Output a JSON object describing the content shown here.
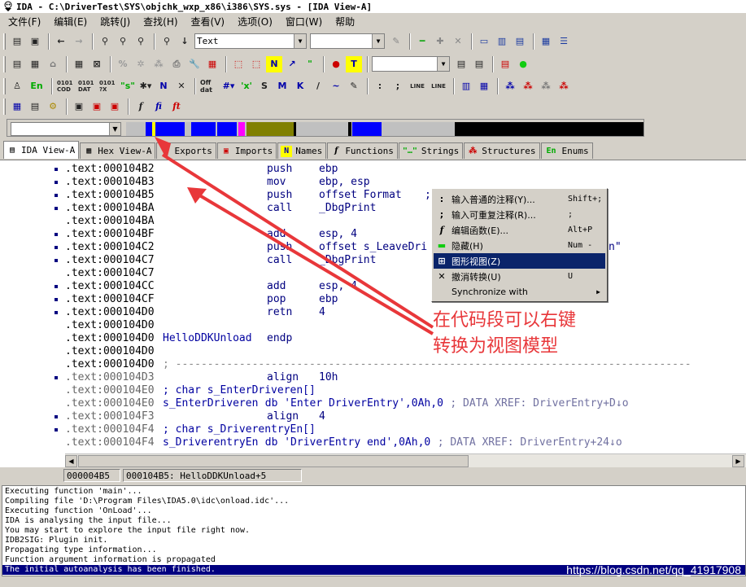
{
  "window": {
    "title": "IDA - C:\\DriverTest\\SYS\\objchk_wxp_x86\\i386\\SYS.sys - [IDA View-A]"
  },
  "menu": [
    "文件(F)",
    "编辑(E)",
    "跳转(J)",
    "查找(H)",
    "查看(V)",
    "选项(O)",
    "窗口(W)",
    "帮助"
  ],
  "toolbar": {
    "segment_combo_value": "Text",
    "second_combo_value": ""
  },
  "tabs": [
    {
      "label": "IDA View-A",
      "icon": "ida-view-icon"
    },
    {
      "label": "Hex View-A",
      "icon": "hex-view-icon"
    },
    {
      "label": "Exports",
      "icon": "exports-icon"
    },
    {
      "label": "Imports",
      "icon": "imports-icon"
    },
    {
      "label": "Names",
      "icon": "names-icon"
    },
    {
      "label": "Functions",
      "icon": "functions-icon"
    },
    {
      "label": "Strings",
      "icon": "strings-icon"
    },
    {
      "label": "Structures",
      "icon": "structures-icon"
    },
    {
      "label": "Enums",
      "icon": "enums-icon"
    }
  ],
  "disasm": [
    {
      "addr": ".text:000104B2",
      "mnem": "push",
      "ops": "ebp",
      "dot": true
    },
    {
      "addr": ".text:000104B3",
      "mnem": "mov",
      "ops": "ebp, esp",
      "dot": true
    },
    {
      "addr": ".text:000104B5",
      "mnem": "push",
      "ops": "offset Format",
      "tail": ";",
      "dot": true
    },
    {
      "addr": ".text:000104BA",
      "mnem": "call",
      "ops": "_DbgPrint",
      "dot": true
    },
    {
      "addr": ".text:000104BA",
      "mnem": "",
      "ops": ""
    },
    {
      "addr": ".text:000104BF",
      "mnem": "add",
      "ops": "esp, 4",
      "dot": true
    },
    {
      "addr": ".text:000104C2",
      "mnem": "push",
      "ops": "offset s_LeaveDri",
      "tail": "n\"",
      "dot": true
    },
    {
      "addr": ".text:000104C7",
      "mnem": "call",
      "ops": "_DbgPrint",
      "dot": true
    },
    {
      "addr": ".text:000104C7",
      "mnem": "",
      "ops": ""
    },
    {
      "addr": ".text:000104CC",
      "mnem": "add",
      "ops": "esp, 4",
      "dot": true
    },
    {
      "addr": ".text:000104CF",
      "mnem": "pop",
      "ops": "ebp",
      "dot": true
    },
    {
      "addr": ".text:000104D0",
      "mnem": "retn",
      "ops": "4",
      "dot": true
    },
    {
      "addr": ".text:000104D0",
      "mnem": "",
      "ops": ""
    },
    {
      "addr": ".text:000104D0",
      "label": "HelloDDKUnload",
      "mnem": "endp",
      "ops": ""
    },
    {
      "addr": ".text:000104D0",
      "mnem": "",
      "ops": ""
    },
    {
      "addr": ".text:000104D0",
      "dash": "; ---------------------------------------------------------------------------------"
    },
    {
      "addr": ".text:000104D3",
      "mnem": "align",
      "ops": "10h",
      "grey": true,
      "dot": true
    },
    {
      "addr": ".text:000104E0",
      "label": "; char s_EnterDriveren[]",
      "grey": true
    },
    {
      "addr": ".text:000104E0",
      "label": "s_EnterDriveren",
      "rest": "db 'Enter DriverEntry',0Ah,0",
      "cmt": "; DATA XREF: DriverEntry+D↓o",
      "grey": true
    },
    {
      "addr": ".text:000104F3",
      "mnem": "align",
      "ops": "4",
      "grey": true,
      "dot": true
    },
    {
      "addr": ".text:000104F4",
      "label": "; char s_DriverentryEn[]",
      "grey": true,
      "dot": true
    },
    {
      "addr": ".text:000104F4",
      "label": "s_DriverentryEn",
      "rest": "db 'DriverEntry end',0Ah,0",
      "cmt": "; DATA XREF: DriverEntry+24↓o",
      "grey": true
    }
  ],
  "status": {
    "offset": "000004B5",
    "location": "000104B5: HelloDDKUnload+5"
  },
  "log": [
    "Executing function 'main'...",
    "Compiling file 'D:\\Program Files\\IDA5.0\\idc\\onload.idc'...",
    "Executing function 'OnLoad'...",
    "IDA is analysing the input file...",
    "You may start to explore the input file right now.",
    "IDB2SIG: Plugin init.",
    "Propagating type information...",
    "Function argument information is propagated",
    "The initial autoanalysis has been finished."
  ],
  "context_menu": [
    {
      "icon": ":",
      "label": "输入普通的注释(Y)...",
      "shortcut": "Shift+;",
      "name": "ctx-enter-comment",
      "icon_name": "colon-icon"
    },
    {
      "icon": ";",
      "label": "输入可重复注释(R)...",
      "shortcut": ";",
      "name": "ctx-enter-repeatable-comment",
      "icon_name": "semicolon-icon"
    },
    {
      "icon": "f",
      "label": "编辑函数(E)...",
      "shortcut": "Alt+P",
      "name": "ctx-edit-function",
      "icon_name": "function-icon"
    },
    {
      "icon": "▬",
      "label": "隐藏(H)",
      "shortcut": "Num -",
      "name": "ctx-hide",
      "icon_name": "minus-icon"
    },
    {
      "icon": "⊞",
      "label": "图形视图(Z)",
      "shortcut": "",
      "name": "ctx-graph-view",
      "icon_name": "graph-view-icon",
      "highlight": true
    },
    {
      "icon": "✕",
      "label": "撤消转换(U)",
      "shortcut": "U",
      "name": "ctx-undefine",
      "icon_name": "cross-icon"
    },
    {
      "icon": "",
      "label": "Synchronize with",
      "shortcut": "▶",
      "name": "ctx-synchronize",
      "icon_name": "submenu-arrow-icon"
    }
  ],
  "annotation": {
    "line1": "在代码段可以右键",
    "line2": "转换为视图模型"
  },
  "watermark": "https://blog.csdn.net/qq_41917908",
  "colors": {
    "annotation": "#e8373a",
    "selection": "#0a246a",
    "code": "#000080"
  }
}
